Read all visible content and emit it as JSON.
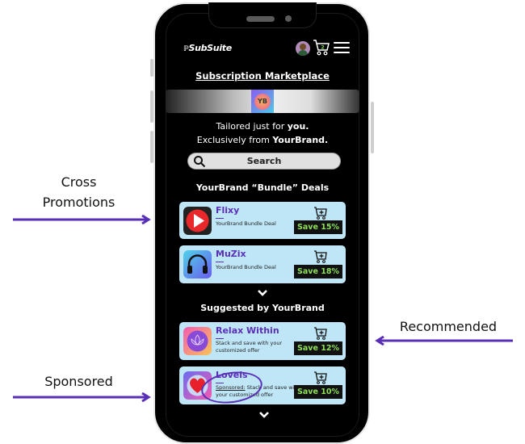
{
  "app": {
    "logo_text": "SubSuite",
    "cart_count": "2"
  },
  "page": {
    "title": "Subscription Marketplace",
    "brand_logo_text": "YB",
    "tagline_line1_prefix": "Tailored just for ",
    "tagline_line1_bold": "you.",
    "tagline_line2_prefix": "Exclusively from ",
    "tagline_line2_bold": "YourBrand."
  },
  "search": {
    "label": "Search"
  },
  "bundle_section": {
    "title": "YourBrand “Bundle” Deals",
    "items": [
      {
        "name": "Flixy",
        "description": "YourBrand Bundle Deal",
        "save": "Save 15%",
        "icon": "play-icon"
      },
      {
        "name": "MuZix",
        "description": "YourBrand Bundle Deal",
        "save": "Save 18%",
        "icon": "headphones-icon"
      }
    ]
  },
  "suggested_section": {
    "title": "Suggested by YourBrand",
    "items": [
      {
        "name": "Relax Within",
        "description": "Stack and save with your customized offer",
        "save": "Save 12%",
        "icon": "lotus-icon"
      },
      {
        "name": "Lovels",
        "sponsored_label": "Sponsored:",
        "description": " Stack and save with your customized offer",
        "save": "Save 10%",
        "icon": "heart-icon"
      }
    ]
  },
  "annotations": {
    "cross_promotions_line1": "Cross",
    "cross_promotions_line2": "Promotions",
    "recommended": "Recommended",
    "sponsored": "Sponsored"
  },
  "colors": {
    "accent_purple": "#5a2fb8",
    "card_bg": "#bfe6f7",
    "save_green": "#8ee05a"
  }
}
